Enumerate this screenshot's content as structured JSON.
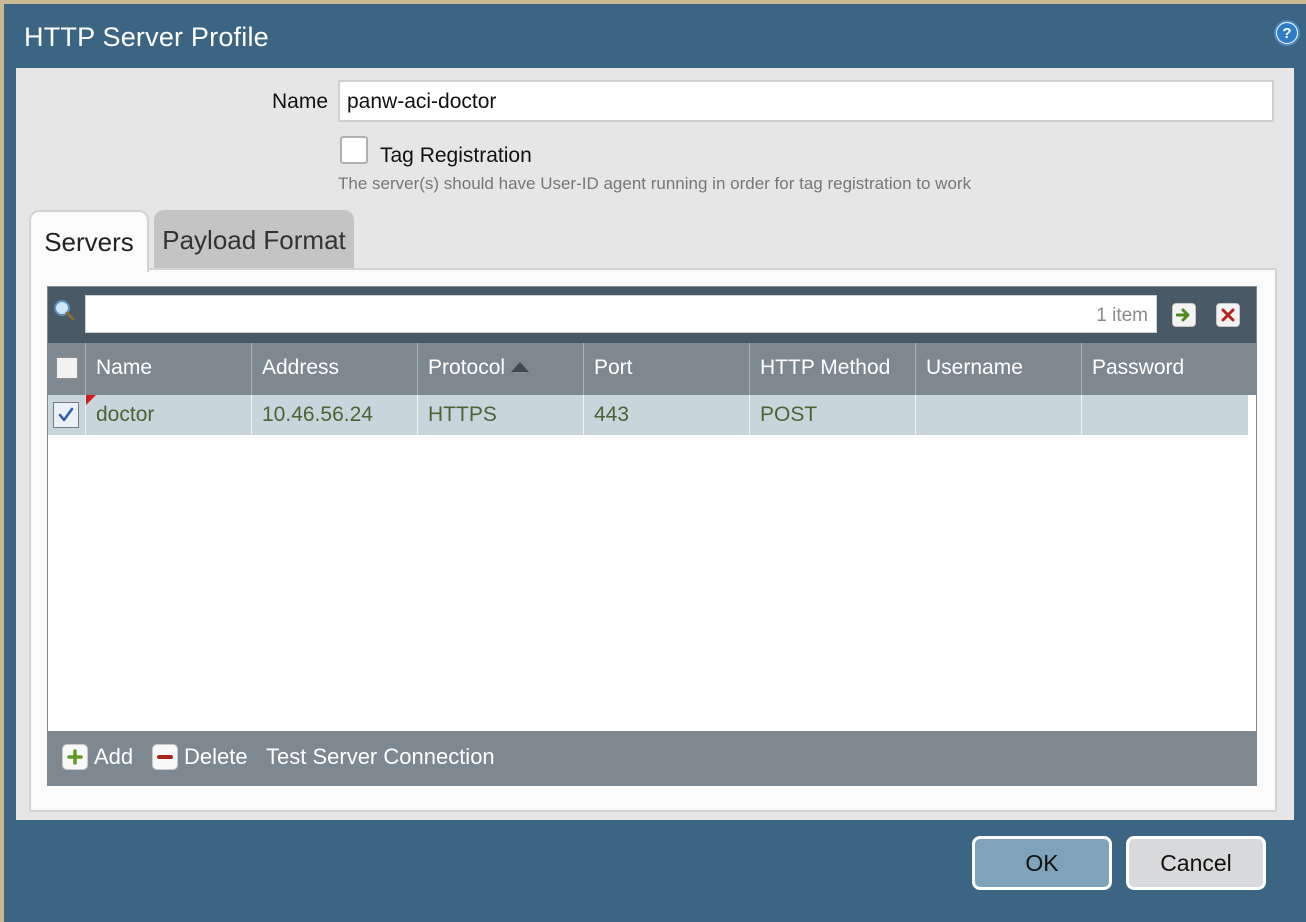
{
  "dialog": {
    "title": "HTTP Server Profile",
    "help_icon": "help-icon"
  },
  "form": {
    "name_label": "Name",
    "name_value": "panw-aci-doctor",
    "tag_registration_label": "Tag Registration",
    "tag_registration_checked": false,
    "tag_registration_help": "The server(s) should have User-ID agent running in order for tag registration to work"
  },
  "tabs": [
    {
      "label": "Servers",
      "active": true
    },
    {
      "label": "Payload Format",
      "active": false
    }
  ],
  "grid": {
    "search_value": "",
    "item_count": "1 item",
    "columns": [
      "Name",
      "Address",
      "Protocol",
      "Port",
      "HTTP Method",
      "Username",
      "Password"
    ],
    "sort_column": "Protocol",
    "sort_direction": "ascending",
    "rows": [
      {
        "selected": true,
        "name": "doctor",
        "address": "10.46.56.24",
        "protocol": "HTTPS",
        "port": "443",
        "http_method": "POST",
        "username": "",
        "password": ""
      }
    ]
  },
  "footer_actions": {
    "add": "Add",
    "delete": "Delete",
    "test": "Test Server Connection"
  },
  "buttons": {
    "ok": "OK",
    "cancel": "Cancel"
  },
  "colors": {
    "titlebar": "#3c6584",
    "grid_header": "#7d8891",
    "selected_row": "#c9d5dc",
    "cell_text": "#4b6534",
    "ok_button": "#7ea3bb"
  }
}
